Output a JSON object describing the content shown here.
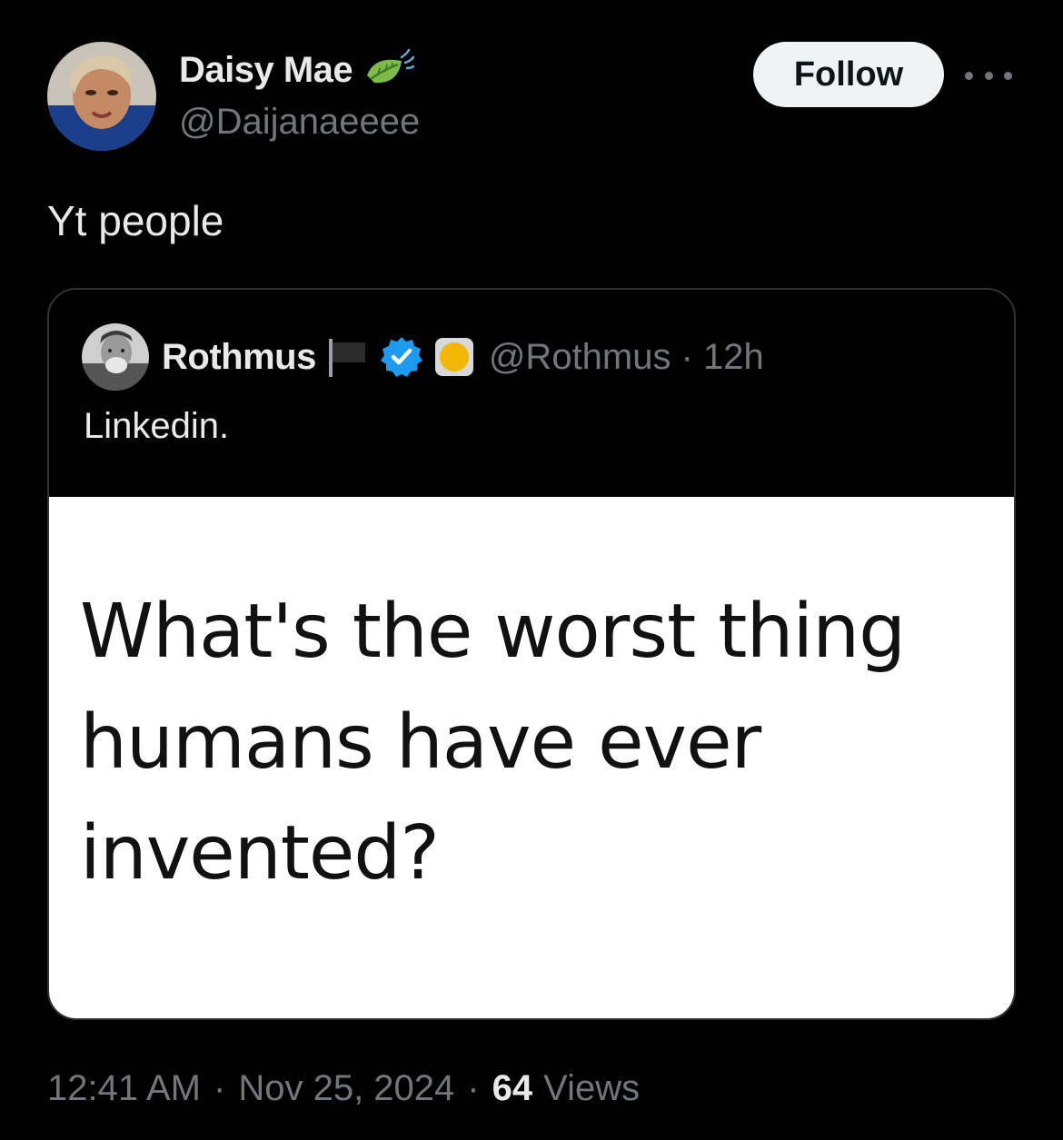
{
  "author": {
    "display_name": "Daisy Mae",
    "handle": "@Daijanaeeee",
    "badge_icon": "leaf-icon"
  },
  "follow_button": {
    "label": "Follow"
  },
  "more_button": {
    "icon": "more-icon"
  },
  "tweet": {
    "text": "Yt people"
  },
  "quoted_tweet": {
    "display_name": "Rothmus",
    "icons": [
      "flag-icon",
      "verified-icon",
      "yellow-circle-icon"
    ],
    "handle_time": "@Rothmus · 12h",
    "text": "Linkedin.",
    "image_text": "What's the worst thing humans have ever invented?"
  },
  "meta": {
    "time": "12:41 AM",
    "separator": "·",
    "date": "Nov 25, 2024",
    "views_count": "64",
    "views_label": "Views"
  },
  "colors": {
    "background": "#000000",
    "text_primary": "#e7e9ea",
    "text_secondary": "#71767b",
    "follow_bg": "#eff3f4",
    "verified_blue": "#1d9bf0",
    "border": "#2f3336"
  }
}
